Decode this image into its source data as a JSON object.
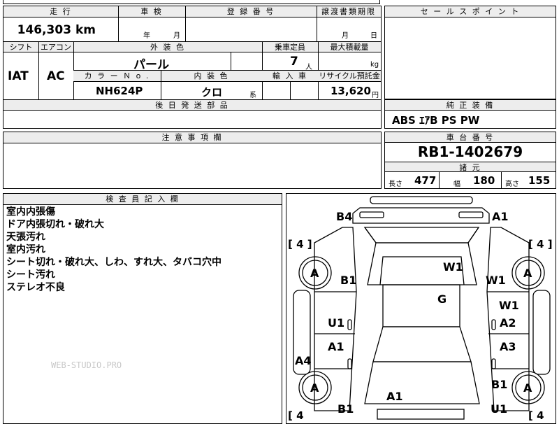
{
  "top_row": {
    "mileage_label": "走 行",
    "mileage_value": "146,303",
    "mileage_unit": "km",
    "inspection_label": "車 検",
    "inspection_year": "年",
    "inspection_month": "月",
    "registration_label": "登 録 番 号",
    "doc_deadline_label": "譲渡書類期限",
    "doc_month": "月",
    "doc_day": "日"
  },
  "mid_row": {
    "shift_label": "シフト",
    "ac_label": "エアコン",
    "exterior_label": "外 装 色",
    "capacity_label": "乗車定員",
    "max_load_label": "最大積載量",
    "shift_value": "IAT",
    "ac_value": "AC",
    "exterior_value": "パール",
    "capacity_value": "7",
    "capacity_unit": "人",
    "load_unit": "kg",
    "color_no_label": "カ ラ ー Ｎ o .",
    "interior_label": "内 装 色",
    "import_label": "輸 入 車",
    "recycle_label": "リサイクル預託金",
    "color_no_value": "NH624P",
    "interior_value": "クロ",
    "interior_suffix": "系",
    "recycle_value": "13,620",
    "recycle_unit": "円",
    "later_parts_label": "後 日 発 送 部 品"
  },
  "sales": {
    "label": "セ ー ル ス ポ イ ン ト"
  },
  "equipment": {
    "label": "純 正 装 備",
    "value": "ABS ｴｱB PS PW"
  },
  "notes": {
    "label": "注 意 事 項 欄"
  },
  "chassis": {
    "label": "車 台 番 号",
    "value": "RB1-1402679",
    "specs_label": "諸 元",
    "length_label": "長さ",
    "length_value": "477",
    "width_label": "幅",
    "width_value": "180",
    "height_label": "高さ",
    "height_value": "155"
  },
  "inspector": {
    "label": "検 査 員 記 入 欄",
    "remarks": [
      "室内内張傷",
      "ドア内張切れ・破れ大",
      "天張汚れ",
      "室内汚れ",
      "シート切れ・破れ大、しわ、すれ大、タバコ穴中",
      "シート汚れ",
      "ステレオ不良"
    ],
    "watermark": "WEB-STUDIO.PRO"
  },
  "diagram": {
    "tire_fl": "[ 4 ]",
    "tire_fr": "[ 4 ]",
    "tire_rl": "[ 4",
    "tire_rr": "[ 4",
    "wheel": "A",
    "marks": {
      "b4": "B4",
      "a1_front": "A1",
      "w1_windshield": "W1",
      "b1_left": "B1",
      "w1_right": "W1",
      "g_roof": "G",
      "u1_left": "U1",
      "w1_right_door": "W1",
      "a2_right": "A2",
      "a1_left_rear": "A1",
      "a3_right": "A3",
      "a4_left": "A4",
      "b1_right_rear": "B1",
      "a1_rear": "A1",
      "b1_rear_left": "B1",
      "u1_rear_right": "U1"
    }
  }
}
